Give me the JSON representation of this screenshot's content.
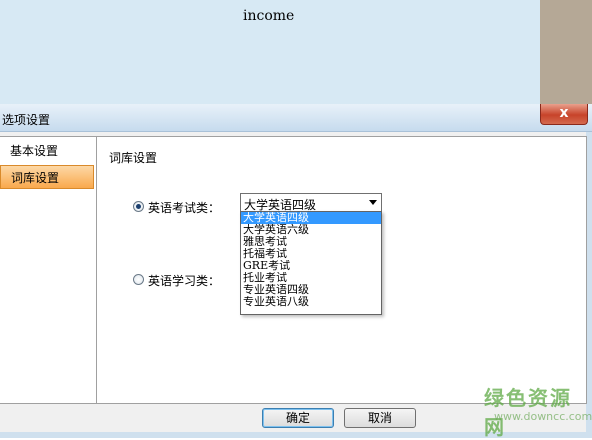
{
  "background_app": {
    "title": "income"
  },
  "dialog": {
    "title": "选项设置",
    "close_glyph": "x"
  },
  "nav": {
    "items": [
      {
        "label": "基本设置",
        "active": false
      },
      {
        "label": "词库设置",
        "active": true
      }
    ]
  },
  "content": {
    "section_title": "词库设置",
    "exam_radio": {
      "label": "英语考试类：",
      "checked": true
    },
    "study_radio": {
      "label": "英语学习类：",
      "checked": false
    },
    "combo": {
      "selected": "大学英语四级"
    },
    "dropdown_options": [
      "大学英语四级",
      "大学英语六级",
      "雅思考试",
      "托福考试",
      "GRE考试",
      "托业考试",
      "专业英语四级",
      "专业英语八级"
    ]
  },
  "buttons": {
    "ok": "确定",
    "cancel": "取消"
  },
  "watermark": {
    "name": "绿色资源网",
    "url": "www.downcc.com"
  },
  "colors": {
    "selection": "#3399ff",
    "nav_active": "#f9a94d"
  }
}
